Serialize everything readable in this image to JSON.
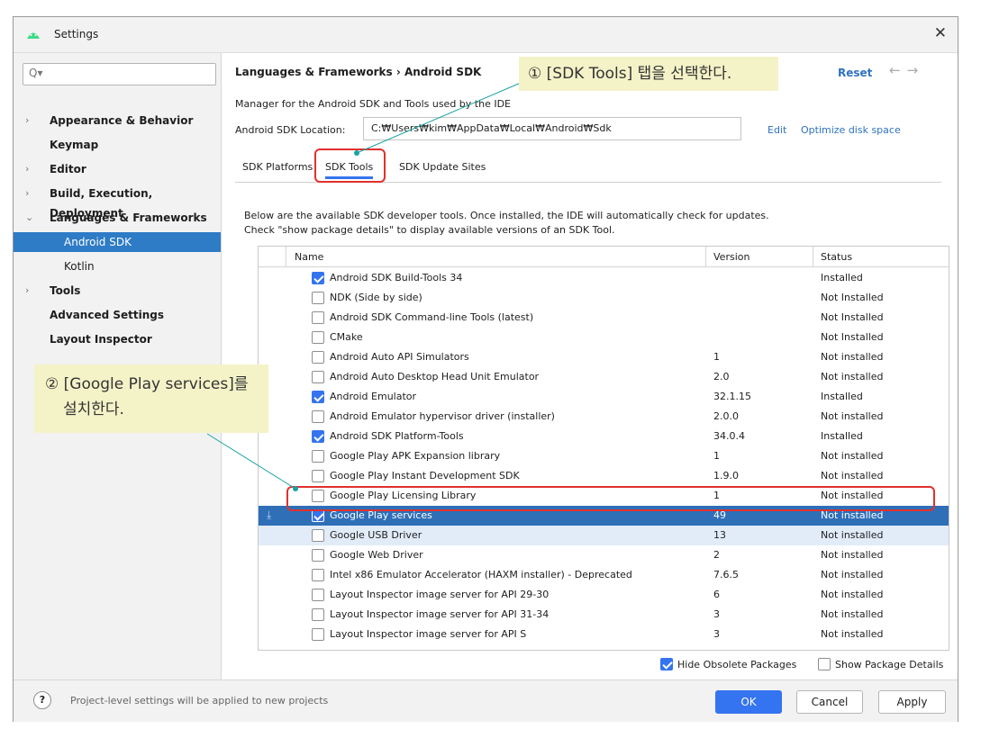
{
  "window": {
    "title": "Settings",
    "close_glyph": "✕"
  },
  "sidebar": {
    "search_placeholder": "Q▾",
    "items": [
      {
        "label": "Appearance & Behavior",
        "chevron": "›"
      },
      {
        "label": "Keymap",
        "chevron": ""
      },
      {
        "label": "Editor",
        "chevron": "›"
      },
      {
        "label": "Build, Execution, Deployment",
        "chevron": "›"
      },
      {
        "label": "Languages & Frameworks",
        "chevron": "⌄"
      },
      {
        "label": "Android SDK",
        "chevron": ""
      },
      {
        "label": "Kotlin",
        "chevron": ""
      },
      {
        "label": "Tools",
        "chevron": "›"
      },
      {
        "label": "Advanced Settings",
        "chevron": ""
      },
      {
        "label": "Layout Inspector",
        "chevron": ""
      }
    ]
  },
  "header": {
    "breadcrumb": "Languages & Frameworks  ›  Android SDK",
    "reset": "Reset",
    "back": "←",
    "forward": "→"
  },
  "main": {
    "description": "Manager for the Android SDK and Tools used by the IDE",
    "location_label": "Android SDK Location:",
    "location_value": "C:₩Users₩kim₩AppData₩Local₩Android₩Sdk",
    "edit": "Edit",
    "optimize": "Optimize disk space",
    "tabs": [
      "SDK Platforms",
      "SDK Tools",
      "SDK Update Sites"
    ],
    "info_line1": "Below are the available SDK developer tools. Once installed, the IDE will automatically check for updates.",
    "info_line2": "Check \"show package details\" to display available versions of an SDK Tool."
  },
  "table": {
    "columns": [
      "Name",
      "Version",
      "Status"
    ],
    "rows": [
      {
        "name": "Android SDK Build-Tools 34",
        "version": "",
        "status": "Installed",
        "checked": true
      },
      {
        "name": "NDK (Side by side)",
        "version": "",
        "status": "Not Installed",
        "checked": false
      },
      {
        "name": "Android SDK Command-line Tools (latest)",
        "version": "",
        "status": "Not Installed",
        "checked": false
      },
      {
        "name": "CMake",
        "version": "",
        "status": "Not Installed",
        "checked": false
      },
      {
        "name": "Android Auto API Simulators",
        "version": "1",
        "status": "Not installed",
        "checked": false
      },
      {
        "name": "Android Auto Desktop Head Unit Emulator",
        "version": "2.0",
        "status": "Not installed",
        "checked": false
      },
      {
        "name": "Android Emulator",
        "version": "32.1.15",
        "status": "Installed",
        "checked": true
      },
      {
        "name": "Android Emulator hypervisor driver (installer)",
        "version": "2.0.0",
        "status": "Not installed",
        "checked": false
      },
      {
        "name": "Android SDK Platform-Tools",
        "version": "34.0.4",
        "status": "Installed",
        "checked": true
      },
      {
        "name": "Google Play APK Expansion library",
        "version": "1",
        "status": "Not installed",
        "checked": false
      },
      {
        "name": "Google Play Instant Development SDK",
        "version": "1.9.0",
        "status": "Not installed",
        "checked": false
      },
      {
        "name": "Google Play Licensing Library",
        "version": "1",
        "status": "Not installed",
        "checked": false
      },
      {
        "name": "Google Play services",
        "version": "49",
        "status": "Not installed",
        "checked": true
      },
      {
        "name": "Google USB Driver",
        "version": "13",
        "status": "Not installed",
        "checked": false
      },
      {
        "name": "Google Web Driver",
        "version": "2",
        "status": "Not installed",
        "checked": false
      },
      {
        "name": "Intel x86 Emulator Accelerator (HAXM installer) - Deprecated",
        "version": "7.6.5",
        "status": "Not installed",
        "checked": false
      },
      {
        "name": "Layout Inspector image server for API 29-30",
        "version": "6",
        "status": "Not installed",
        "checked": false
      },
      {
        "name": "Layout Inspector image server for API 31-34",
        "version": "3",
        "status": "Not installed",
        "checked": false
      },
      {
        "name": "Layout Inspector image server for API S",
        "version": "3",
        "status": "Not installed",
        "checked": false
      }
    ],
    "download_glyph": "⤓"
  },
  "options": {
    "hide_obsolete": "Hide Obsolete Packages",
    "show_details": "Show Package Details"
  },
  "footer": {
    "help": "?",
    "text": "Project-level settings will be applied to new projects",
    "ok": "OK",
    "cancel": "Cancel",
    "apply": "Apply"
  },
  "annotations": {
    "callout1": "① [SDK Tools] 탭을 선택한다.",
    "callout2_line1": "② [Google Play services]를",
    "callout2_line2": "설치한다.",
    "highlight_color": "#e0312e",
    "leader_color": "#1aa3a3"
  },
  "colors": {
    "accent": "#3574f0",
    "selection": "#2e7bc6",
    "link": "#2e72c0"
  }
}
